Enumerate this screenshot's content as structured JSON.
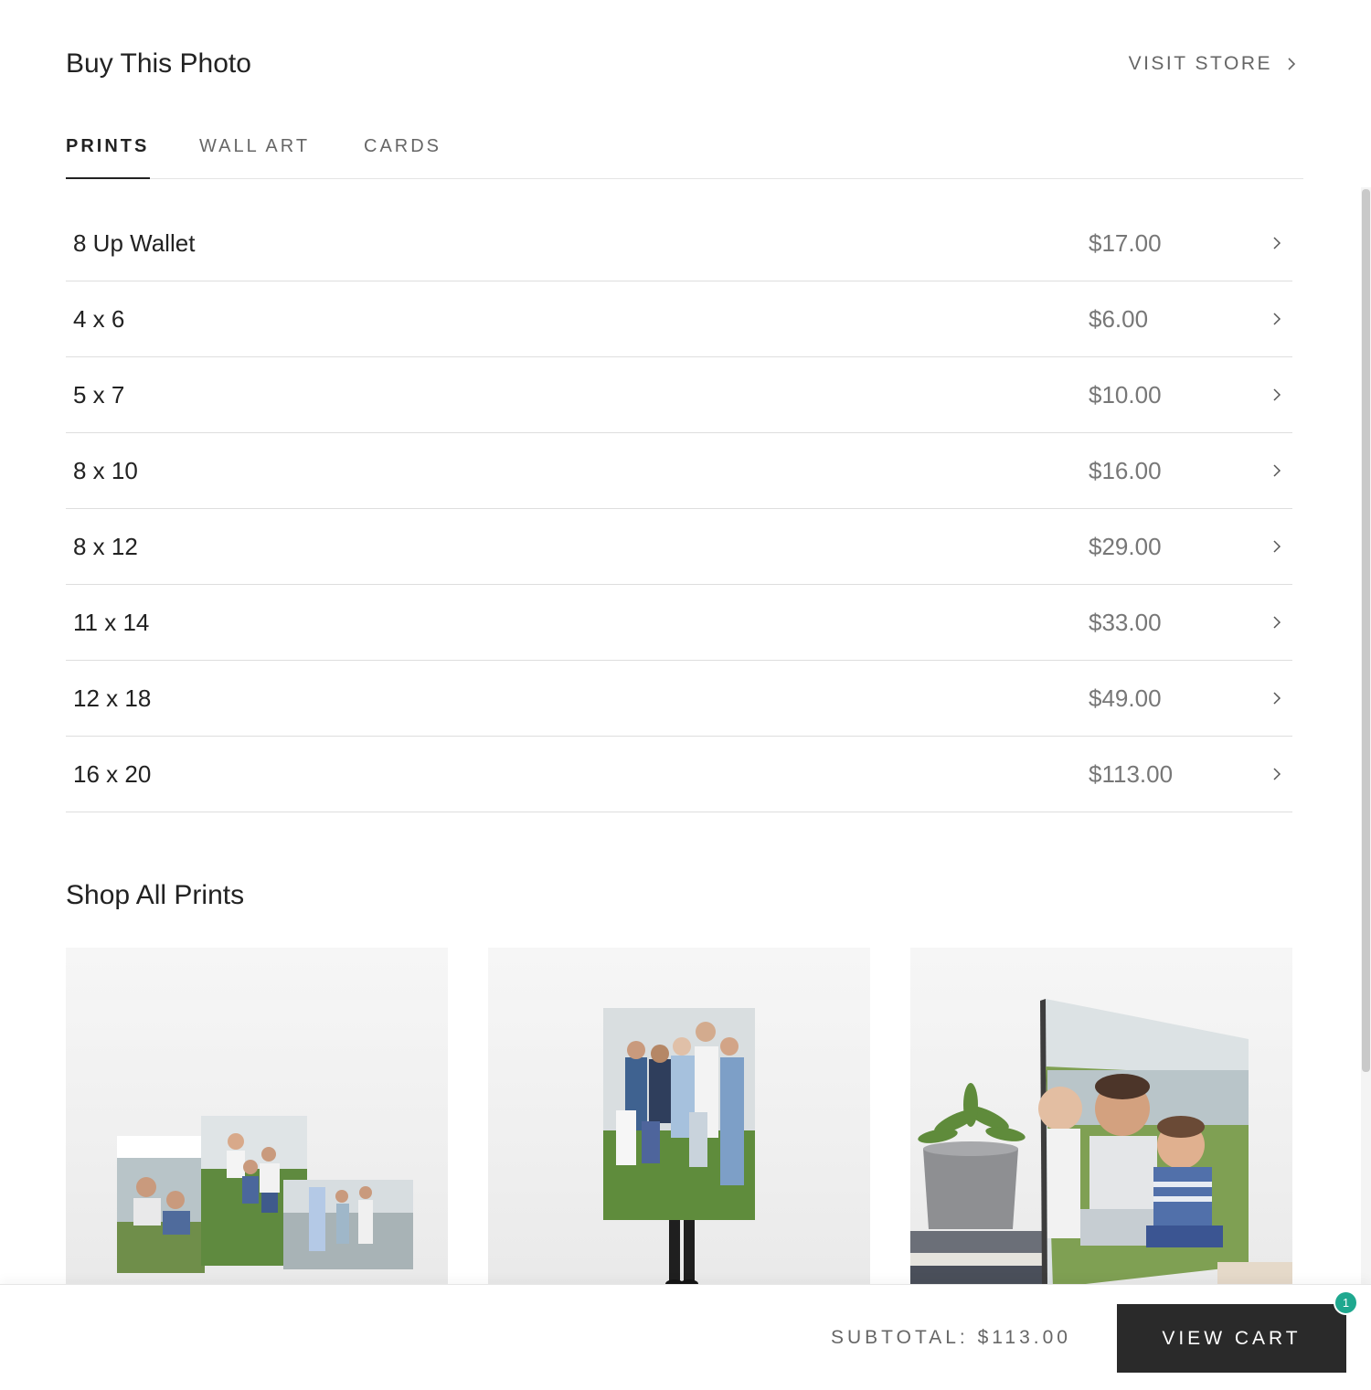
{
  "header": {
    "title": "Buy This Photo",
    "visit_store_label": "VISIT STORE"
  },
  "tabs": [
    {
      "label": "PRINTS",
      "active": true
    },
    {
      "label": "WALL ART",
      "active": false
    },
    {
      "label": "CARDS",
      "active": false
    }
  ],
  "products": [
    {
      "name": "8 Up Wallet",
      "price": "$17.00"
    },
    {
      "name": "4 x 6",
      "price": "$6.00"
    },
    {
      "name": "5 x 7",
      "price": "$10.00"
    },
    {
      "name": "8 x 10",
      "price": "$16.00"
    },
    {
      "name": "8 x 12",
      "price": "$29.00"
    },
    {
      "name": "11 x 14",
      "price": "$33.00"
    },
    {
      "name": "12 x 18",
      "price": "$49.00"
    },
    {
      "name": "16 x 20",
      "price": "$113.00"
    }
  ],
  "shop_all": {
    "title": "Shop All Prints",
    "cards": [
      {
        "image": "print-collection-family-photos"
      },
      {
        "image": "person-holding-large-family-print"
      },
      {
        "image": "standing-print-with-plant-and-books"
      }
    ]
  },
  "cart": {
    "subtotal_label": "SUBTOTAL: $113.00",
    "view_cart_label": "VIEW CART",
    "badge_count": "1"
  },
  "colors": {
    "accent_badge": "#1fa88f",
    "button_bg": "#2a2a2a"
  }
}
